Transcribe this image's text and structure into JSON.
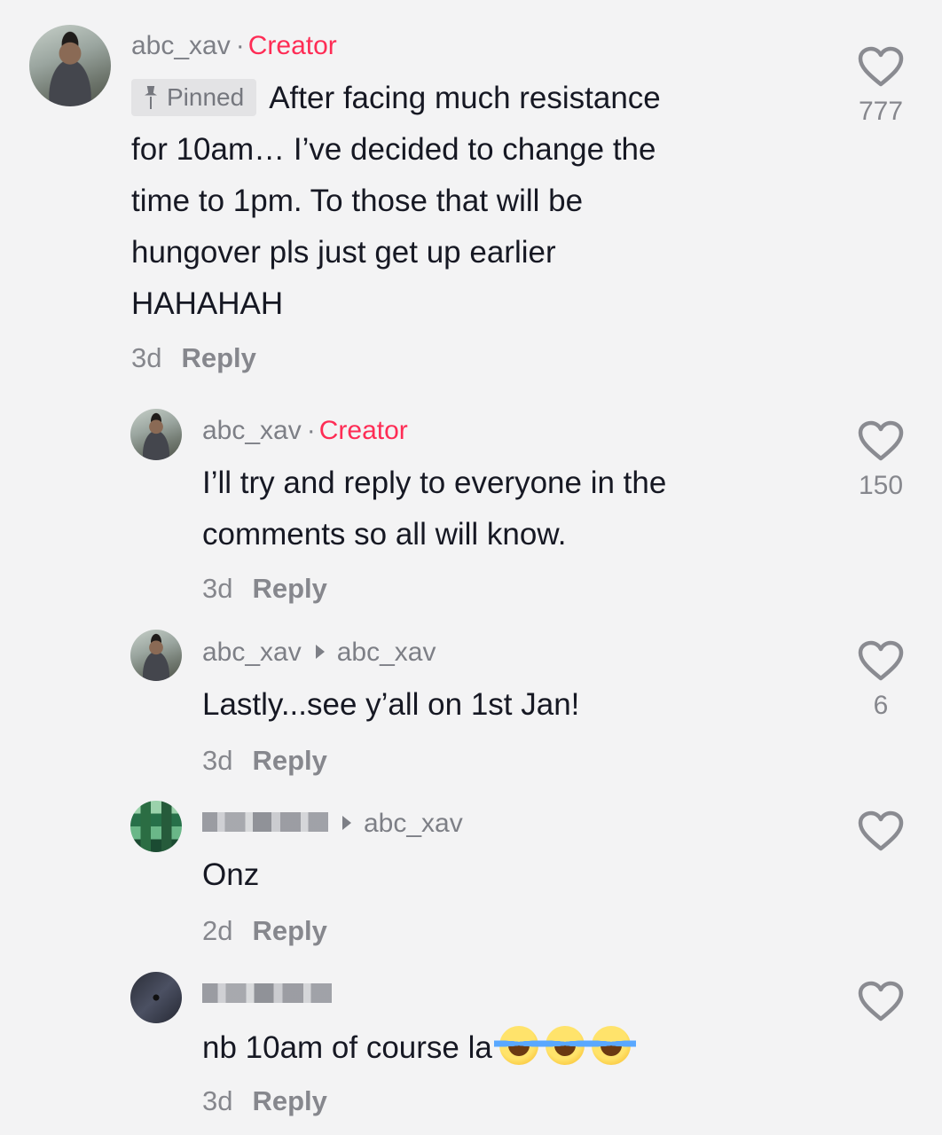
{
  "comments": [
    {
      "username": "abc_xav",
      "badge": "Creator",
      "pinned_label": "Pinned",
      "lines": [
        "After facing much resistance",
        "for 10am… I’ve decided to change the",
        "time to 1pm. To those that will be",
        "hungover pls just get up earlier",
        "HAHAHAH"
      ],
      "age": "3d",
      "reply_label": "Reply",
      "likes": "777",
      "avatar_icon": "profile-photo"
    },
    {
      "username": "abc_xav",
      "badge": "Creator",
      "lines": [
        "I’ll try and reply to everyone in the",
        "comments so all will know."
      ],
      "age": "3d",
      "reply_label": "Reply",
      "likes": "150",
      "avatar_icon": "profile-photo"
    },
    {
      "username": "abc_xav",
      "reply_to": "abc_xav",
      "lines": [
        "Lastly...see y’all on 1st Jan!"
      ],
      "age": "3d",
      "reply_label": "Reply",
      "likes": "6",
      "avatar_icon": "profile-photo"
    },
    {
      "username_blurred": true,
      "reply_to": "abc_xav",
      "lines": [
        "Onz"
      ],
      "age": "2d",
      "reply_label": "Reply",
      "likes": "",
      "avatar_icon": "pixelated-avatar"
    },
    {
      "username_blurred": true,
      "lines": [
        "nb 10am of course la"
      ],
      "emoji": [
        "face-with-tears-of-joy",
        "face-with-tears-of-joy",
        "face-with-tears-of-joy"
      ],
      "age": "3d",
      "reply_label": "Reply",
      "likes": "",
      "avatar_icon": "pixelated-avatar"
    }
  ],
  "colors": {
    "background": "#f3f3f4",
    "creator_badge": "#fe2c55",
    "secondary_text": "#7d7f86",
    "primary_text": "#161823"
  },
  "icons": {
    "like": "heart-outline-icon",
    "pin": "pin-icon",
    "reply_arrow": "caret-right-icon",
    "emoji": "face-with-tears-of-joy"
  }
}
